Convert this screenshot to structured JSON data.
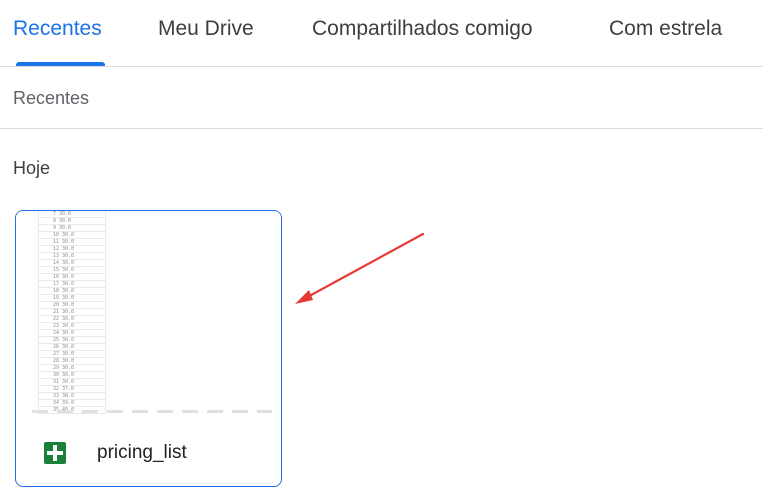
{
  "tabs": [
    {
      "label": "Recentes",
      "active": true
    },
    {
      "label": "Meu Drive",
      "active": false
    },
    {
      "label": "Compartilhados comigo",
      "active": false
    },
    {
      "label": "Com estrela",
      "active": false
    }
  ],
  "section_label": "Recentes",
  "group_label": "Hoje",
  "file": {
    "name": "pricing_list",
    "icon": "google-sheets-icon",
    "preview_rows": [
      "7 30.0",
      "8 30.0",
      "9 30.0",
      "10 30.0",
      "11 30.0",
      "12 30.0",
      "13 30.0",
      "14 30.0",
      "15 30.0",
      "16 30.0",
      "17 30.0",
      "18 30.0",
      "19 30.0",
      "20 30.0",
      "21 30.0",
      "22 30.0",
      "23 30.0",
      "24 30.0",
      "25 30.0",
      "26 30.0",
      "27 30.0",
      "28 30.0",
      "29 30.0",
      "30 30.0",
      "31 30.0",
      "32 37.0",
      "33 38.0",
      "34 39.0",
      "35 40.0"
    ]
  },
  "colors": {
    "accent": "#1a73e8",
    "sheets_green": "#188038",
    "annotation_arrow": "#e53935"
  }
}
